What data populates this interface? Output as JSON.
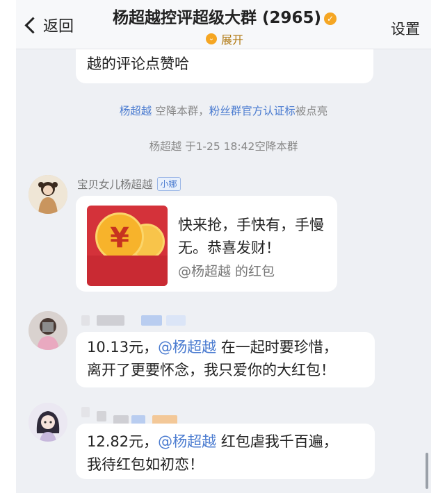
{
  "header": {
    "back_label": "返回",
    "title": "杨超越控评超级大群 (2965)",
    "expand_label": "展开",
    "settings_label": "设置"
  },
  "top_message": {
    "line2": "越的评论点赞哈"
  },
  "system_notices": [
    {
      "name": "杨超越",
      "middle": " 空降本群，",
      "badge": "粉丝群官方认证标",
      "tail": "被点亮"
    },
    {
      "text": "杨超越 于1-25 18:42空降本群"
    }
  ],
  "red_packet_message": {
    "sender": "宝贝女儿杨超越",
    "sender_tag": "小娜",
    "text": "快来抢，手快有，手慢无。恭喜发财！",
    "sub": "@杨超越 的红包",
    "icon": "yuan-coin-icon",
    "currency_symbol": "¥",
    "envelope_color": "#d4323a"
  },
  "messages": [
    {
      "amount": "10.13元，",
      "mention": "@杨超越",
      "line1_rest": " 在一起时要珍惜，",
      "line2": "离开了更要怀念，我只爱你的大红包！"
    },
    {
      "amount": "12.82元，",
      "mention": "@杨超越",
      "line1_rest": " 红包虐我千百遍，",
      "line2": "我待红包如初恋！"
    }
  ],
  "colors": {
    "link_blue": "#4a7bd0",
    "chat_bg": "#eef0f4",
    "gold": "#f5a623"
  }
}
